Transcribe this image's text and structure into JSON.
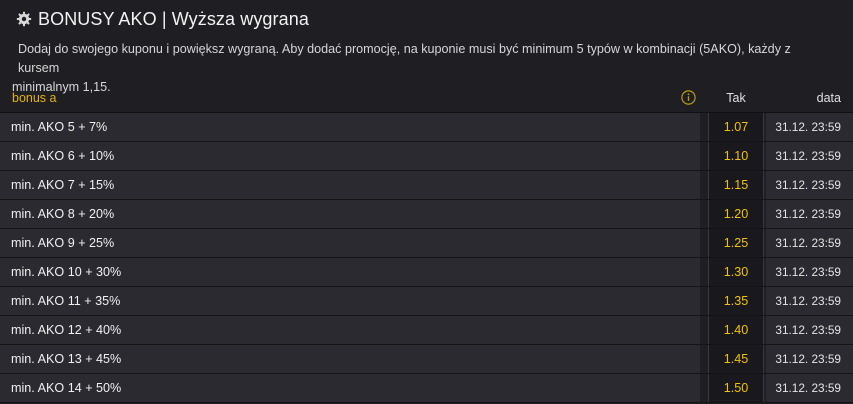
{
  "title": "BONUSY AKO | Wyższa wygrana",
  "description": {
    "line1": "Dodaj do swojego kuponu i powiększ wygraną. Aby dodać promocję, na kuponie musi być minimum 5 typów w kombinacji (5AKO), każdy z kursem",
    "line2": "minimalnym 1,15."
  },
  "table": {
    "header": {
      "label": "bonus a",
      "odds": "Tak",
      "date": "data"
    },
    "rows": [
      {
        "name": "min. AKO 5 + 7%",
        "odds": "1.07",
        "date": "31.12. 23:59"
      },
      {
        "name": "min. AKO 6 + 10%",
        "odds": "1.10",
        "date": "31.12. 23:59"
      },
      {
        "name": "min. AKO 7 + 15%",
        "odds": "1.15",
        "date": "31.12. 23:59"
      },
      {
        "name": "min. AKO 8 + 20%",
        "odds": "1.20",
        "date": "31.12. 23:59"
      },
      {
        "name": "min. AKO 9 + 25%",
        "odds": "1.25",
        "date": "31.12. 23:59"
      },
      {
        "name": "min. AKO 10 + 30%",
        "odds": "1.30",
        "date": "31.12. 23:59"
      },
      {
        "name": "min. AKO 11 + 35%",
        "odds": "1.35",
        "date": "31.12. 23:59"
      },
      {
        "name": "min. AKO 12 + 40%",
        "odds": "1.40",
        "date": "31.12. 23:59"
      },
      {
        "name": "min. AKO 13 + 45%",
        "odds": "1.45",
        "date": "31.12. 23:59"
      },
      {
        "name": "min. AKO 14 + 50%",
        "odds": "1.50",
        "date": "31.12. 23:59"
      }
    ]
  },
  "icons": {
    "title": "gear-badge-icon",
    "info": "info-icon"
  },
  "colors": {
    "accent": "#f2c200",
    "background": "#1f1e23",
    "row": "#2b2a30"
  }
}
